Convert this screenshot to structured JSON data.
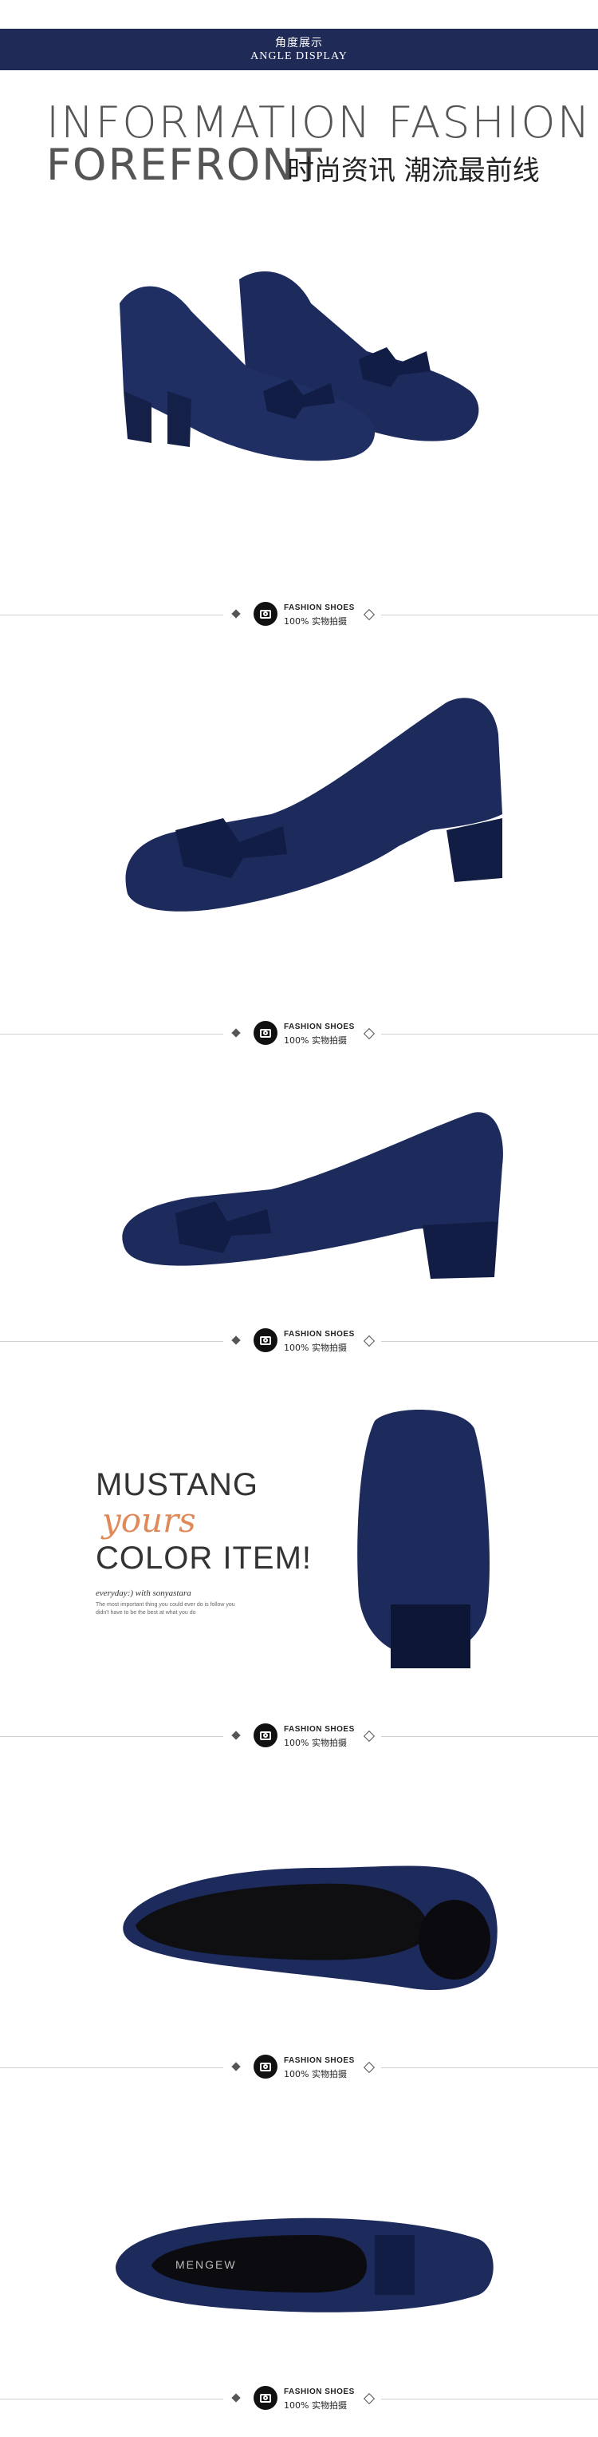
{
  "header": {
    "title_zh": "角度展示",
    "title_en": "ANGLE DISPLAY"
  },
  "hero": {
    "line1": "INFORMATION FASHION",
    "line2": "FOREFRONT",
    "line2_zh": "时尚资讯 潮流最前线"
  },
  "divider": {
    "label_en": "FASHION SHOES",
    "label_zh": "100% 实物拍摄"
  },
  "promo": {
    "word1": "MUSTANG",
    "word2": "yours",
    "word3": "COLOR ITEM!",
    "tagline": "everyday:) with sonyastara",
    "note": "The most important thing you could ever do is follow you didn't have to be the best at what you do"
  },
  "insole_brand": "MENGEW",
  "colors": {
    "header_bg": "#1f2b56",
    "shoe": "#1c2a5c",
    "accent": "#e08a5a"
  }
}
